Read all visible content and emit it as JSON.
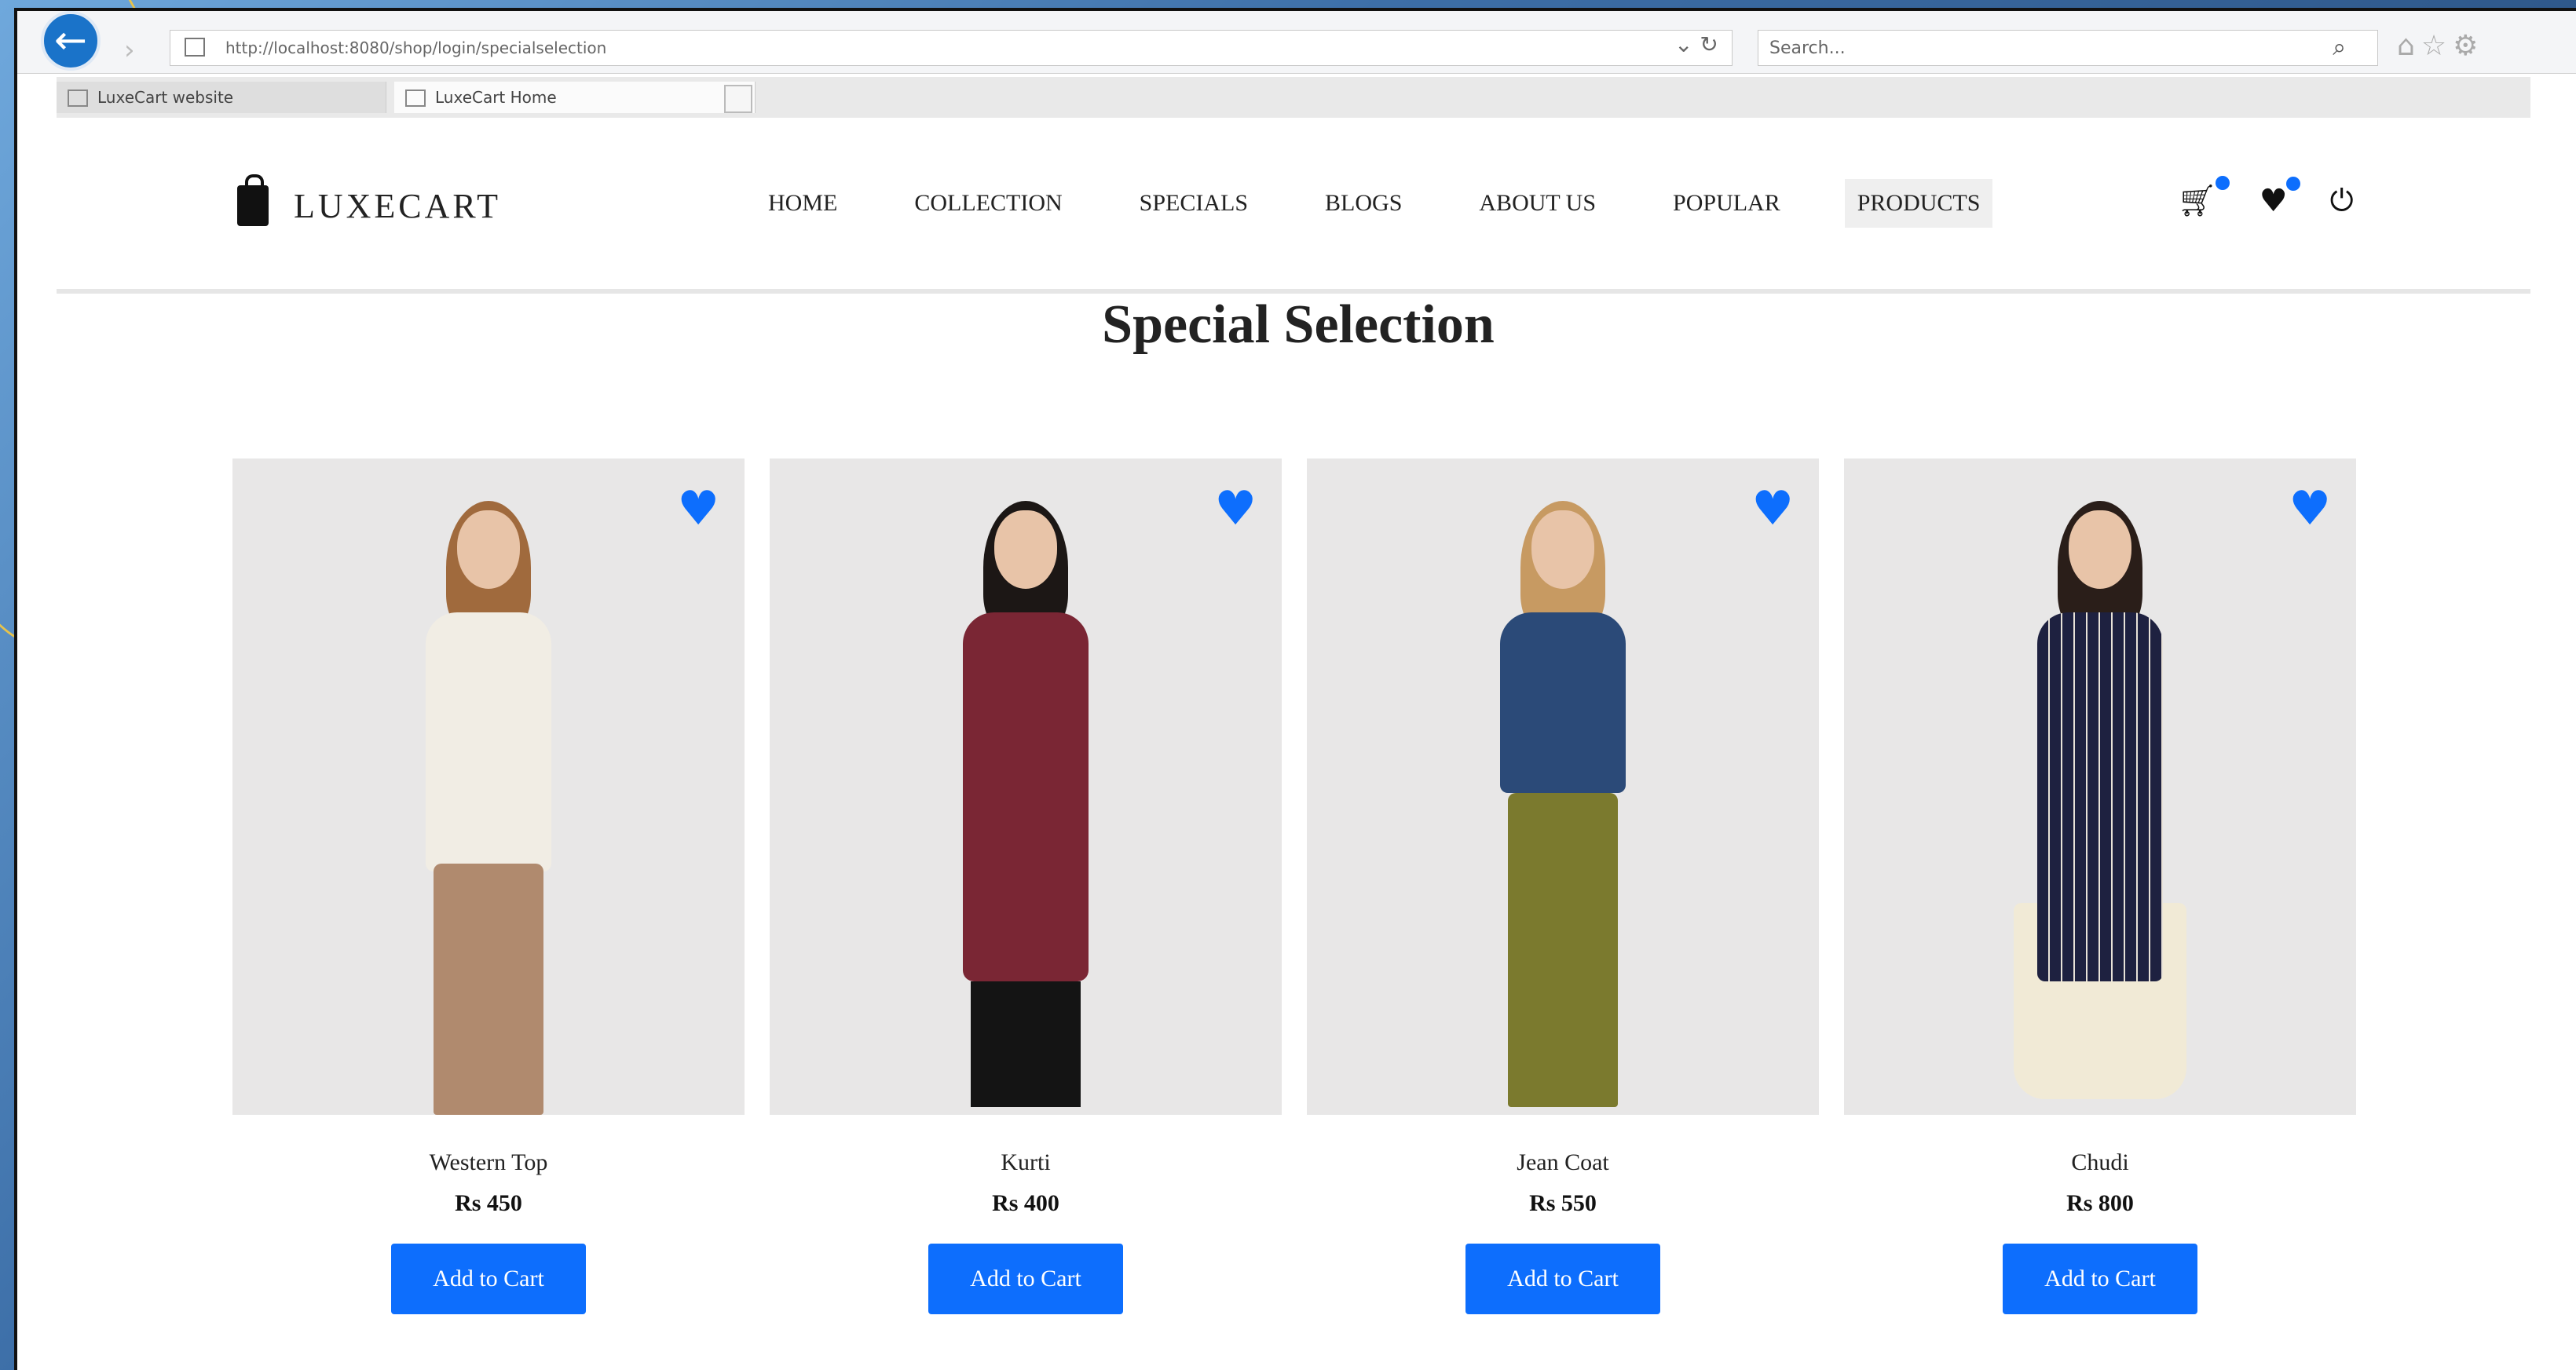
{
  "browser": {
    "url": "http://localhost:8080/shop/login/specialselection",
    "url_host": "localhost",
    "search_placeholder": "Search...",
    "tabs": [
      {
        "label": "LuxeCart website"
      },
      {
        "label": "LuxeCart Home"
      }
    ]
  },
  "site": {
    "brand": "LUXECART",
    "nav": [
      "HOME",
      "COLLECTION",
      "SPECIALS",
      "BLOGS",
      "ABOUT US",
      "POPULAR",
      "PRODUCTS"
    ],
    "active_nav": "PRODUCTS",
    "accent": "#0d6efd"
  },
  "section": {
    "title": "Special Selection"
  },
  "products": [
    {
      "name": "Western Top",
      "price": "Rs 450",
      "button": "Add to Cart"
    },
    {
      "name": "Kurti",
      "price": "Rs 400",
      "button": "Add to Cart"
    },
    {
      "name": "Jean Coat",
      "price": "Rs 550",
      "button": "Add to Cart"
    },
    {
      "name": "Chudi",
      "price": "Rs 800",
      "button": "Add to Cart"
    }
  ]
}
